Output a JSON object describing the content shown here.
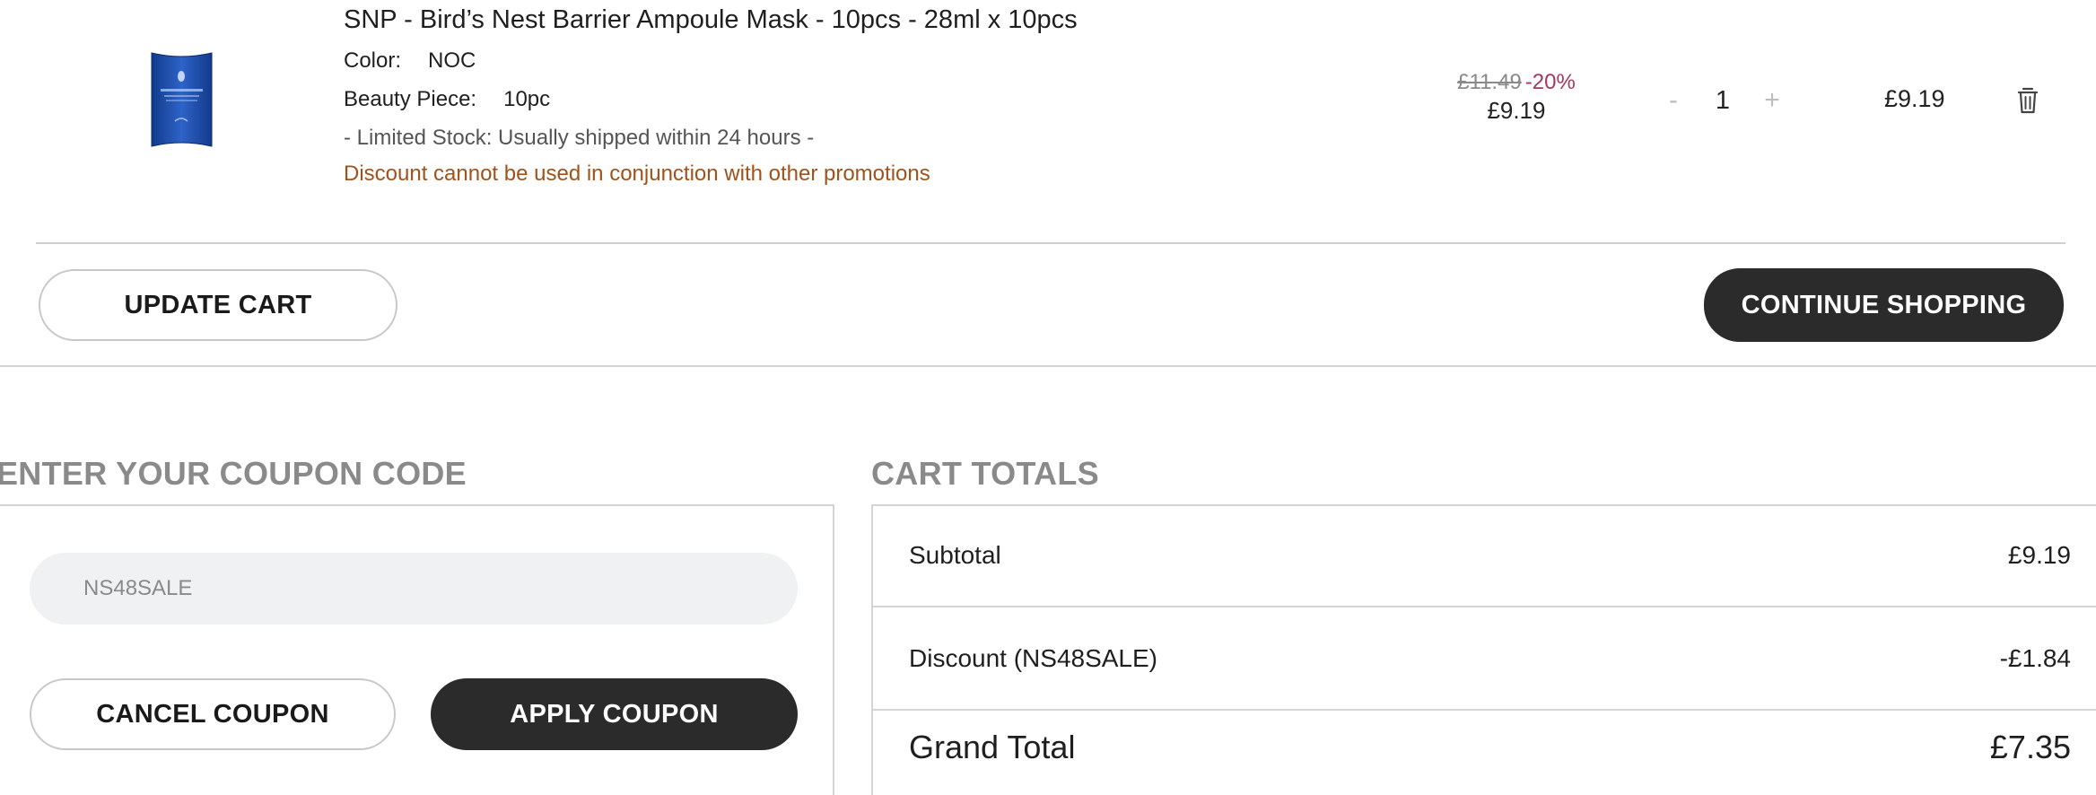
{
  "cart_item": {
    "title": "SNP - Bird’s Nest Barrier Ampoule Mask - 10pcs - 28ml x 10pcs",
    "color_label": "Color:",
    "color_value": "NOC",
    "piece_label": "Beauty Piece:",
    "piece_value": "10pc",
    "stock_note": "- Limited Stock: Usually shipped within 24 hours -",
    "promo_note": "Discount cannot be used in conjunction with other promotions",
    "old_price": "£11.49",
    "discount_pct": "-20%",
    "new_price": "£9.19",
    "qty_minus": "-",
    "quantity": "1",
    "qty_plus": "+",
    "line_total": "£9.19",
    "thumbnail_icon": "product-sachet-image",
    "delete_icon": "trash-icon"
  },
  "cart_actions": {
    "update_label": "UPDATE CART",
    "continue_label": "CONTINUE SHOPPING"
  },
  "coupon": {
    "heading": "ENTER YOUR COUPON CODE",
    "input_value": "NS48SALE",
    "cancel_label": "CANCEL COUPON",
    "apply_label": "APPLY COUPON"
  },
  "totals": {
    "heading": "CART TOTALS",
    "subtotal_label": "Subtotal",
    "subtotal_value": "£9.19",
    "discount_label": "Discount (NS48SALE)",
    "discount_value": "-£1.84",
    "grand_label": "Grand Total",
    "grand_value": "£7.35"
  },
  "colors": {
    "dark_button": "#2b2b2b",
    "promo_text": "#a0521a",
    "discount_pct": "#a8375a",
    "heading_gray": "#8a8a8a",
    "input_bg": "#f0f1f3"
  }
}
